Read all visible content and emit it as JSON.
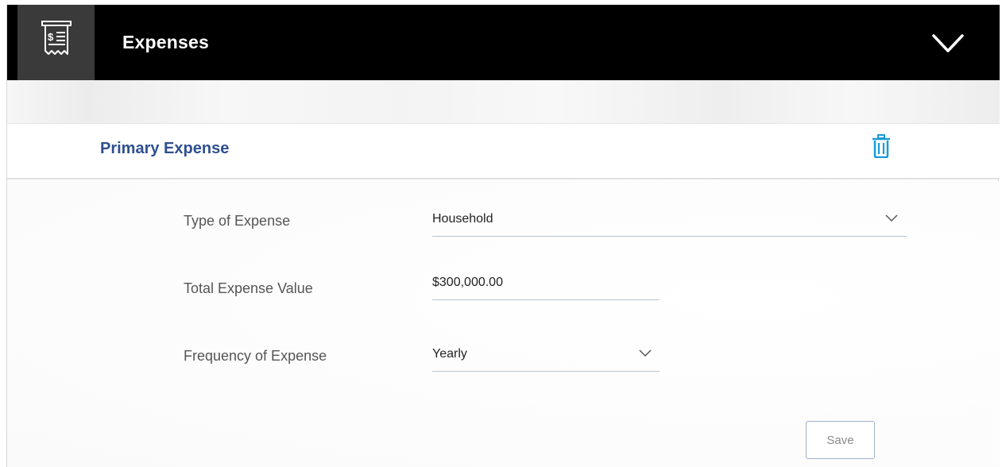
{
  "header": {
    "title": "Expenses",
    "icon": "receipt-dollar-icon",
    "toggle_icon": "chevron-down-icon"
  },
  "section": {
    "title": "Primary Expense",
    "delete_icon": "trash-icon"
  },
  "form": {
    "type_of_expense": {
      "label": "Type of Expense",
      "value": "Household"
    },
    "total_expense_value": {
      "label": "Total Expense Value",
      "value": "$300,000.00"
    },
    "frequency_of_expense": {
      "label": "Frequency of Expense",
      "value": "Yearly"
    },
    "save_label": "Save"
  },
  "colors": {
    "header_bg": "#000000",
    "header_icon_bg": "#3a3a3a",
    "section_title": "#2f4f8f",
    "trash_icon": "#1a9ad6"
  }
}
